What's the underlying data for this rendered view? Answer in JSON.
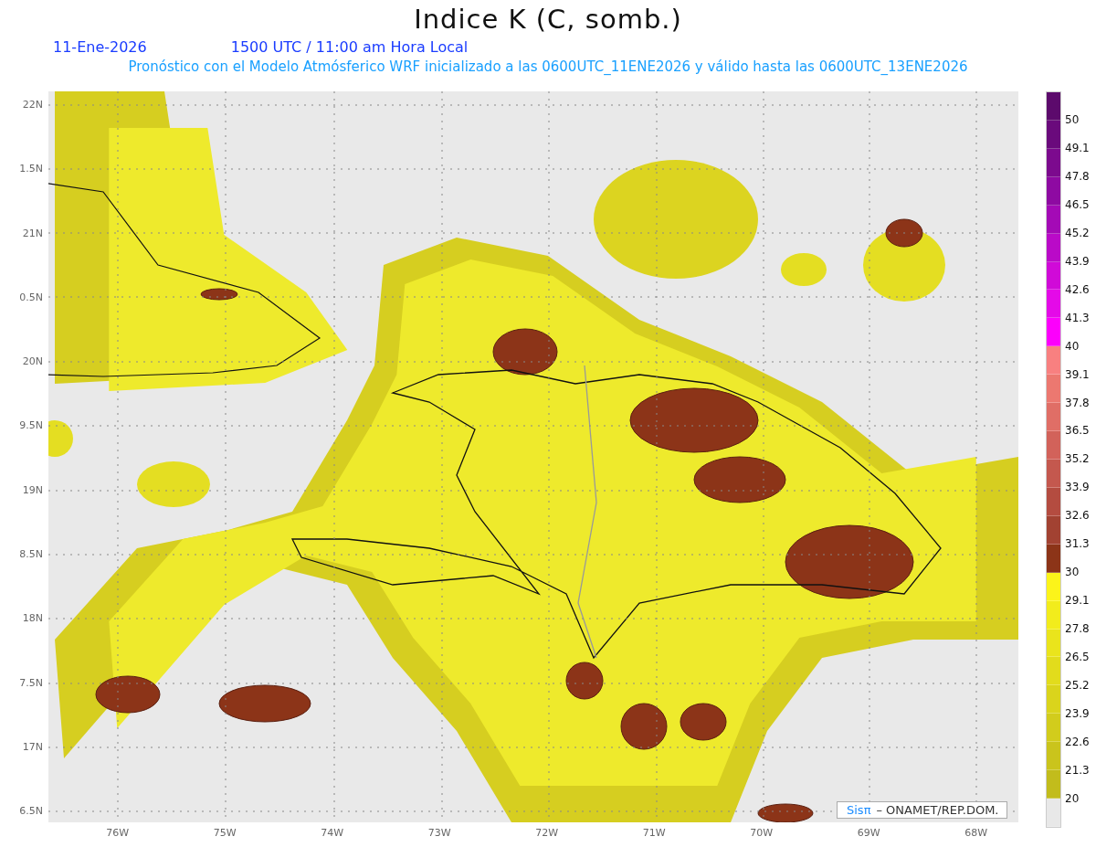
{
  "title": "Indice K (C, somb.)",
  "date": "11-Ene-2026",
  "time": "1500 UTC / 11:00 am Hora Local",
  "subtitle": "Pronóstico con el Modelo Atmósferico WRF inicializado a las 0600UTC_11ENE2026 y válido hasta las  0600UTC_13ENE2026",
  "y_axis": [
    "22N",
    "1.5N",
    "21N",
    "0.5N",
    "20N",
    "9.5N",
    "19N",
    "8.5N",
    "18N",
    "7.5N",
    "17N",
    "6.5N"
  ],
  "x_axis": [
    "76W",
    "75W",
    "74W",
    "73W",
    "72W",
    "71W",
    "70W",
    "69W",
    "68W"
  ],
  "colorbar": {
    "bins": [
      {
        "color": "#5c0a6c"
      },
      {
        "color": "#6a0a7c"
      },
      {
        "color": "#7c0a8e"
      },
      {
        "color": "#8e0aa2"
      },
      {
        "color": "#a40ab6"
      },
      {
        "color": "#ba0ac8"
      },
      {
        "color": "#d00ad8"
      },
      {
        "color": "#e40ae8"
      },
      {
        "color": "#fc00fc"
      },
      {
        "color": "#f88080"
      },
      {
        "color": "#ec7870"
      },
      {
        "color": "#e06e66"
      },
      {
        "color": "#d2625a"
      },
      {
        "color": "#c4584e"
      },
      {
        "color": "#b44c40"
      },
      {
        "color": "#a24232"
      },
      {
        "color": "#8c3418"
      },
      {
        "color": "#fcf41a"
      },
      {
        "color": "#f2ec1c"
      },
      {
        "color": "#eae41c"
      },
      {
        "color": "#e2dc1c"
      },
      {
        "color": "#dad41c"
      },
      {
        "color": "#d2cc1c"
      },
      {
        "color": "#cac41c"
      },
      {
        "color": "#c2bc1c"
      },
      {
        "color": "#e8e8e8"
      }
    ],
    "labels": [
      "50",
      "49.1",
      "47.8",
      "46.5",
      "45.2",
      "43.9",
      "42.6",
      "41.3",
      "40",
      "39.1",
      "37.8",
      "36.5",
      "35.2",
      "33.9",
      "32.6",
      "31.3",
      "30",
      "29.1",
      "27.8",
      "26.5",
      "25.2",
      "23.9",
      "22.6",
      "21.3",
      "20"
    ]
  },
  "credit": {
    "brand": "Sisπ",
    "text": "– ONAMET/REP.DOM."
  }
}
